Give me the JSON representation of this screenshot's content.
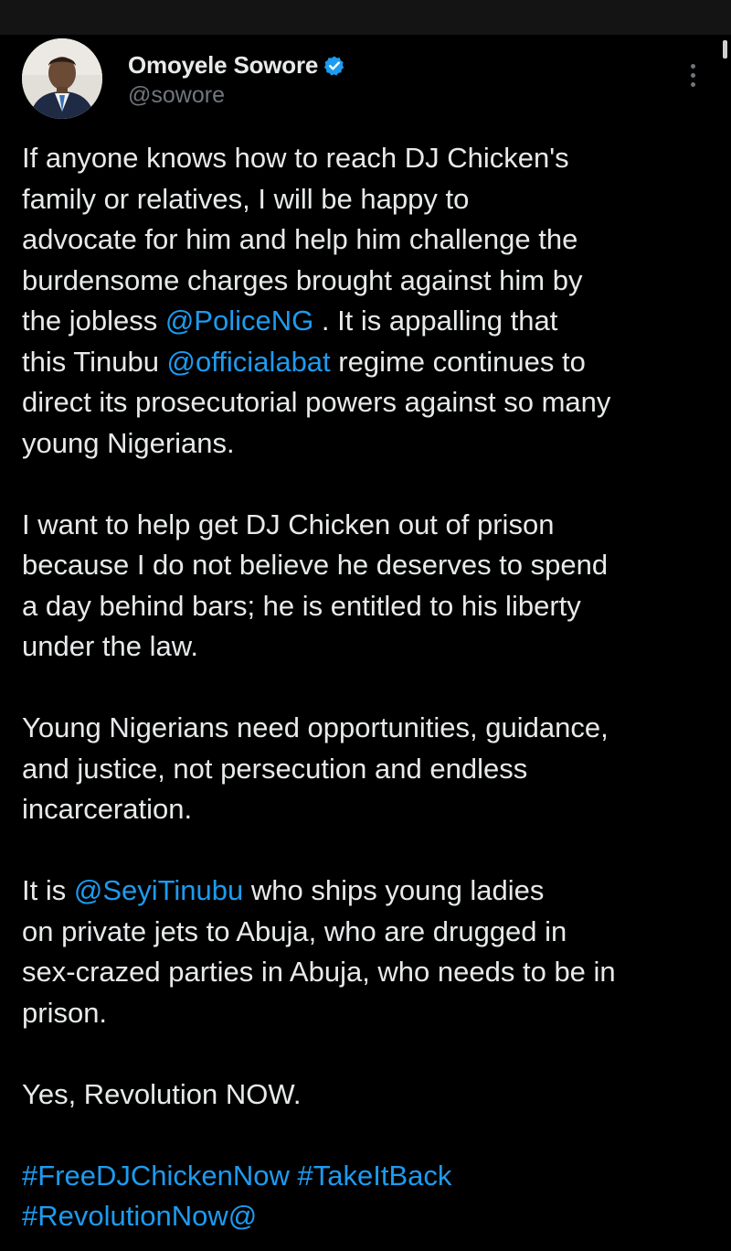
{
  "author": {
    "display_name": "Omoyele Sowore",
    "handle": "@sowore",
    "verified": true
  },
  "colors": {
    "background": "#000000",
    "text": "#e7e9ea",
    "secondary_text": "#71767b",
    "link": "#1d9bf0",
    "verified_badge": "#1d9bf0"
  },
  "icons": {
    "verified": "verified-badge-icon",
    "more": "more-vertical-icon"
  },
  "tweet": {
    "p1": {
      "l1": "If anyone knows how to reach DJ Chicken's",
      "l2": "family or relatives, I will be happy to",
      "l3": "advocate for him and help him challenge the",
      "l4": "burdensome charges brought against him by",
      "l5_pre": "the jobless ",
      "l5_mention": "@PoliceNG",
      "l5_post": " . It is appalling that",
      "l6_pre": "this Tinubu ",
      "l6_mention": "@officialabat",
      "l6_post": " regime continues to",
      "l7": "direct its prosecutorial powers against so many",
      "l8": "young Nigerians."
    },
    "p2": {
      "l1": "I want to help get DJ Chicken out of prison",
      "l2": "because I do not believe he deserves to spend",
      "l3": "a day behind bars; he is entitled to his liberty",
      "l4": "under the law."
    },
    "p3": {
      "l1": "Young Nigerians need opportunities, guidance,",
      "l2": "and justice, not persecution and endless",
      "l3": "incarceration."
    },
    "p4": {
      "l1_pre": "It is ",
      "l1_mention": "@SeyiTinubu",
      "l1_post": " who ships young ladies",
      "l2": "on private jets to Abuja, who are drugged in",
      "l3": "sex-crazed parties in Abuja, who needs to be in",
      "l4": "prison."
    },
    "p5": {
      "l1": "Yes, Revolution NOW."
    },
    "hashtags": {
      "h1": "#FreeDJChickenNow",
      "h2": "#TakeItBack",
      "h3": "#RevolutionNow",
      "trailing": "@"
    }
  }
}
